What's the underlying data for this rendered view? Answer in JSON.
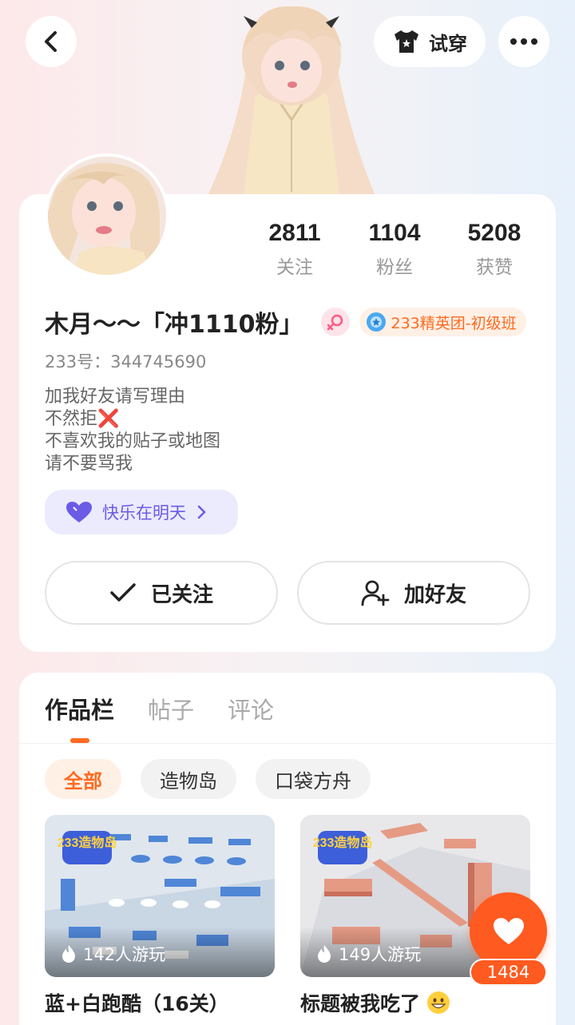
{
  "header": {
    "try_on_label": "试穿",
    "back_icon": "chevron-left-icon",
    "try_on_icon": "tshirt-icon",
    "more_icon": "more-dots-icon"
  },
  "profile": {
    "name": "木月～～「冲1110粉」",
    "gender": "female",
    "rank_badge": "233精英团-初级班",
    "uid_label": "233号：",
    "uid": "344745690",
    "bio": [
      "加我好友请写理由",
      "不然拒",
      "不喜欢我的贴子或地图",
      "请不要骂我"
    ],
    "bio_emoji": "❌",
    "fan_group": "快乐在明天",
    "stats": [
      {
        "value": "2811",
        "label": "关注"
      },
      {
        "value": "1104",
        "label": "粉丝"
      },
      {
        "value": "5208",
        "label": "获赞"
      }
    ],
    "follow_button": "已关注",
    "add_friend_button": "加好友"
  },
  "works": {
    "tabs": [
      "作品栏",
      "帖子",
      "评论"
    ],
    "active_tab": "作品栏",
    "filters": [
      "全部",
      "造物岛",
      "口袋方舟"
    ],
    "active_filter": "全部",
    "games": [
      {
        "title": "蓝+白跑酷（16关）",
        "plays": "142人游玩",
        "logo": "233造物岛",
        "theme_color": "#5b8fd8"
      },
      {
        "title": "标题被我吃了",
        "plays": "149人游玩",
        "logo": "233造物岛",
        "theme_color": "#e59a84"
      }
    ]
  },
  "like": {
    "count": "1484",
    "color": "#ff5a1f"
  },
  "colors": {
    "accent": "#ff6a1f",
    "fan_purple": "#6a5ce6"
  }
}
